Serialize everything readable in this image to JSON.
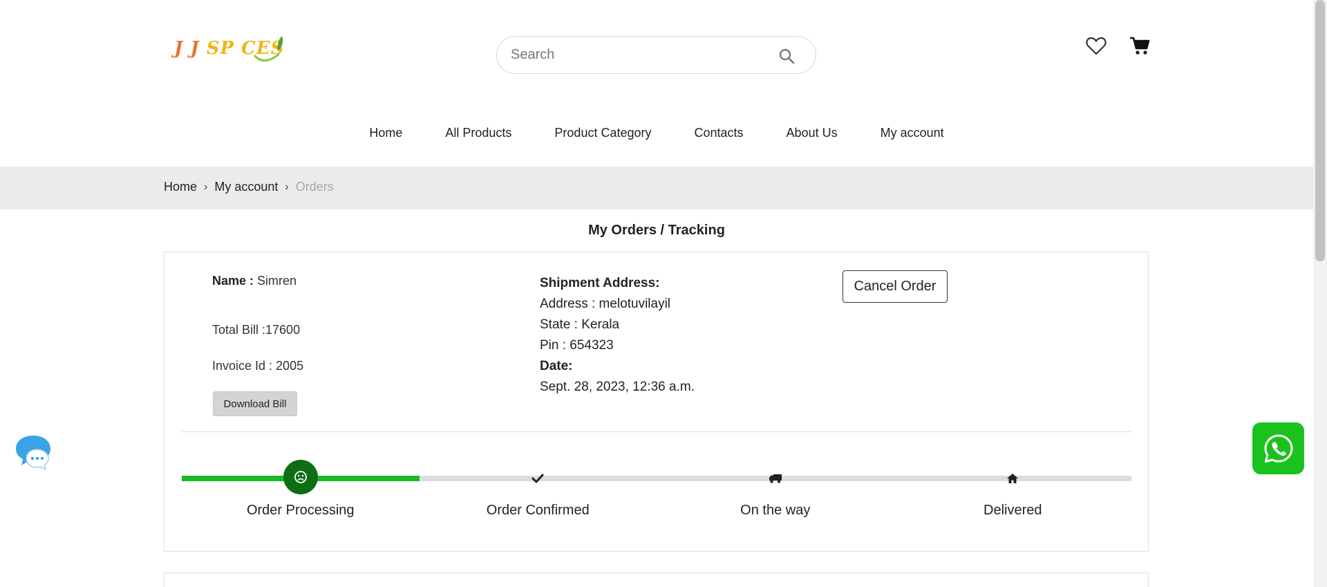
{
  "logo": {
    "part1": "J J ",
    "part2": "SP CES"
  },
  "search": {
    "placeholder": "Search",
    "value": ""
  },
  "nav": {
    "items": [
      "Home",
      "All Products",
      "Product Category",
      "Contacts",
      "About Us",
      "My account"
    ]
  },
  "breadcrumb": {
    "items": [
      "Home",
      "My account"
    ],
    "separator": "›",
    "current": "Orders"
  },
  "page": {
    "title": "My Orders / Tracking"
  },
  "order": {
    "name_label": "Name :",
    "name_value": " Simren",
    "total_bill": "Total Bill :17600",
    "invoice": "Invoice Id : 2005",
    "download_label": "Download Bill",
    "shipment_heading": "Shipment Address:",
    "address": "Address : melotuvilayil",
    "state": "State : Kerala",
    "pin": "Pin : 654323",
    "date_heading": "Date:",
    "date_value": "Sept. 28, 2023, 12:36 a.m.",
    "cancel_label": "Cancel Order"
  },
  "tracking": {
    "progress": 0.25,
    "current_step": 0,
    "steps": [
      {
        "label": "Order Processing",
        "icon": "sad-face-icon"
      },
      {
        "label": "Order Confirmed",
        "icon": "check-icon"
      },
      {
        "label": "On the way",
        "icon": "truck-icon"
      },
      {
        "label": "Delivered",
        "icon": "home-icon"
      }
    ]
  },
  "icons": {
    "search": "search-icon",
    "wishlist": "heart-icon",
    "cart": "cart-icon",
    "chat": "chat-bubble-icon",
    "whatsapp": "whatsapp-icon"
  },
  "colors": {
    "progress_fill": "#1db924",
    "active_step": "#0e6e15",
    "whatsapp": "#1bc21b",
    "breadcrumb_bar": "#ebebeb"
  }
}
